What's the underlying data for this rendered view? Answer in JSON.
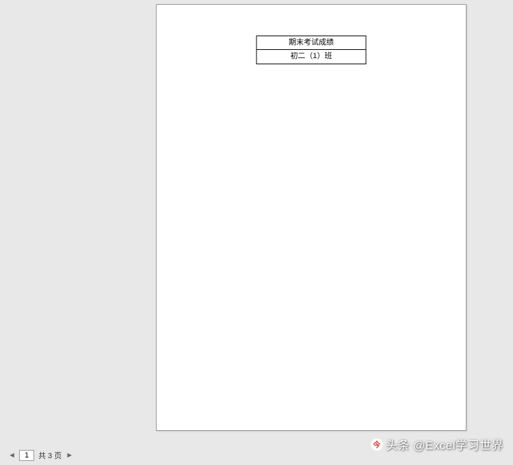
{
  "document": {
    "header": {
      "title": "期末考试成绩",
      "class_name": "初二（1）班"
    }
  },
  "pager": {
    "prev_symbol": "◄",
    "current_page": "1",
    "total_label": "共 3 页",
    "next_symbol": "►"
  },
  "watermark": {
    "icon_text": "今",
    "text": "头条 @Excel学习世界"
  }
}
